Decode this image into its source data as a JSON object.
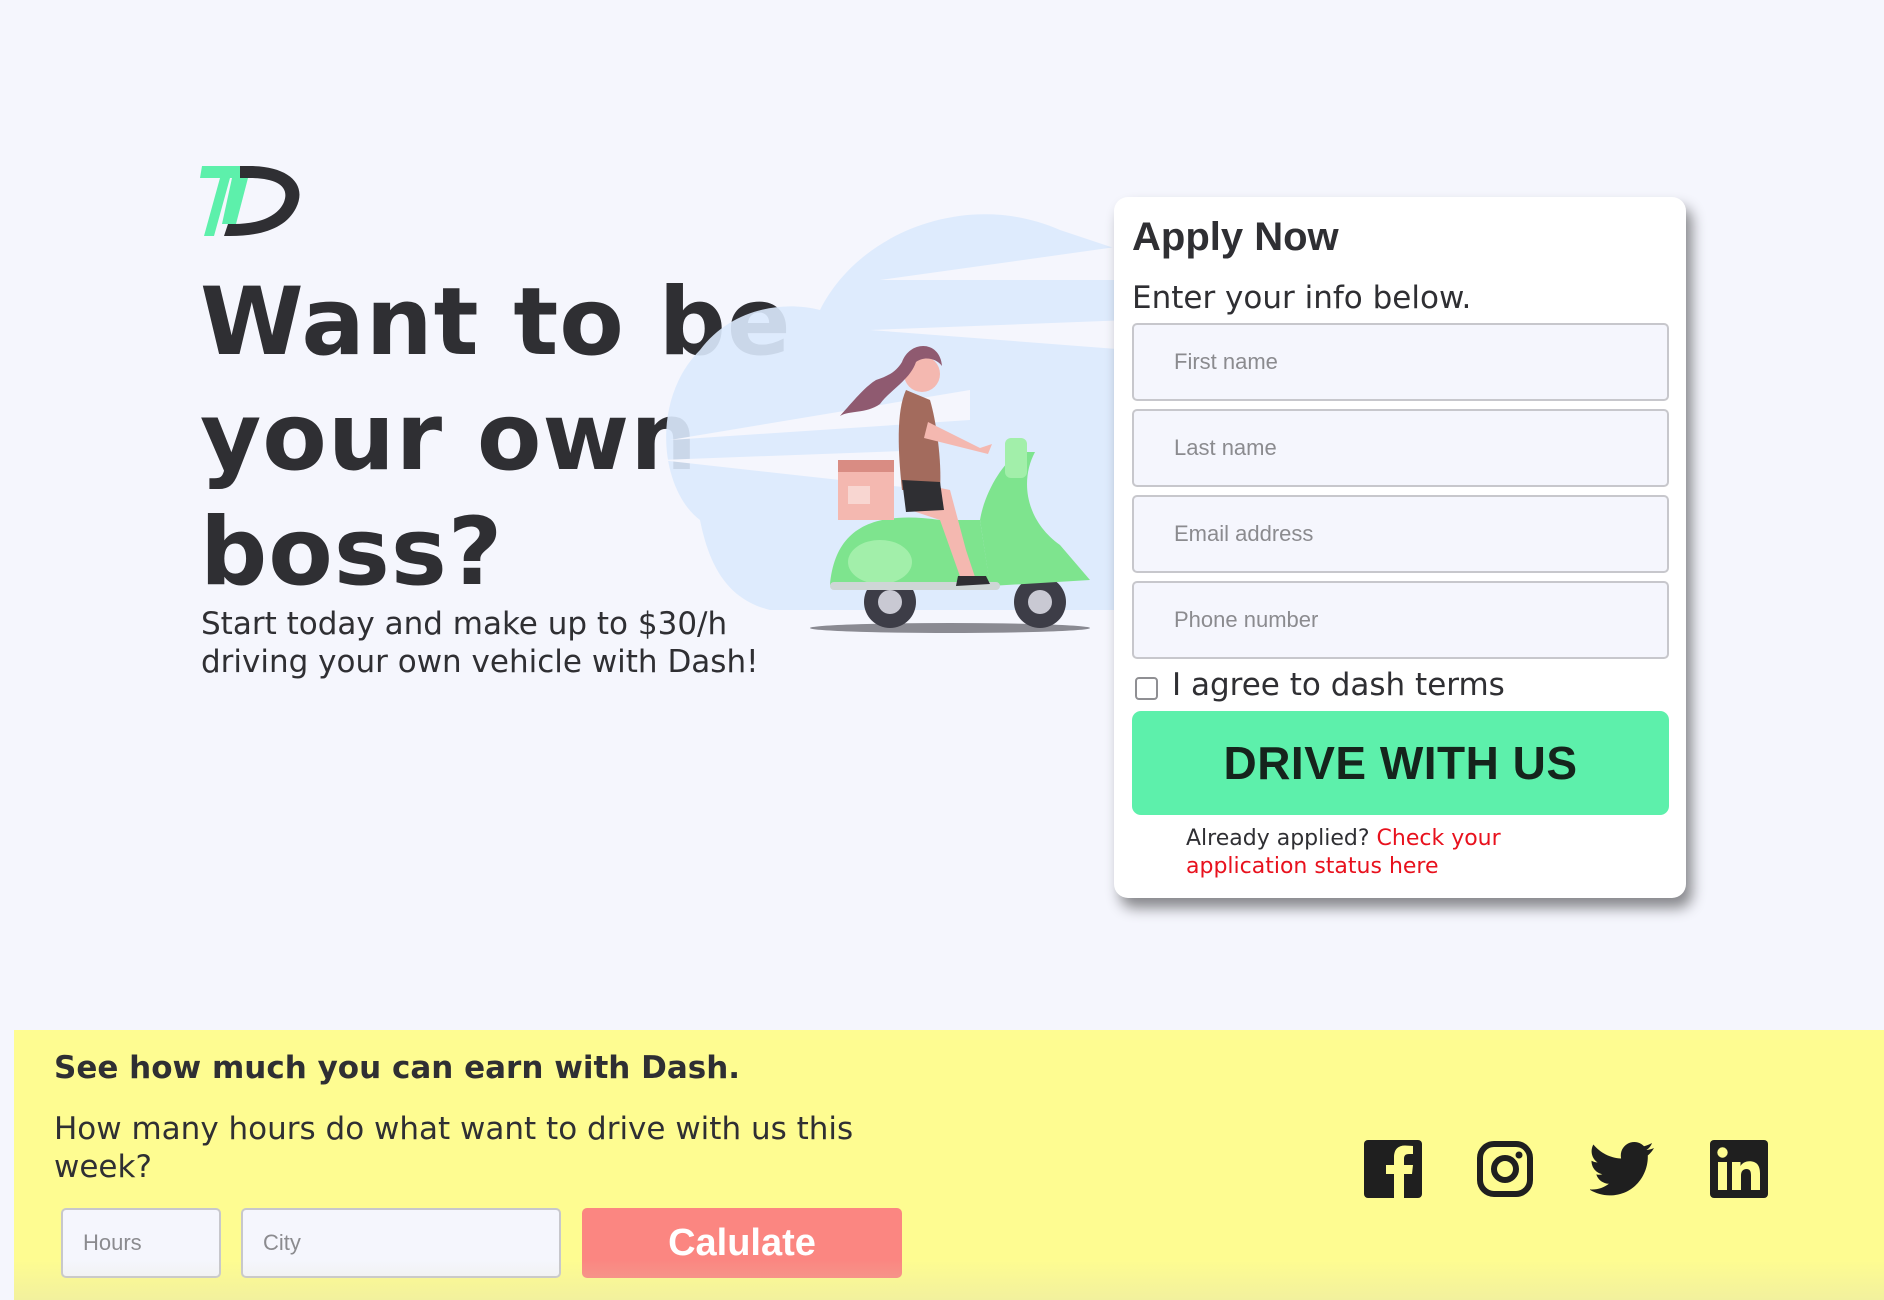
{
  "hero": {
    "logo_icon": "dash-logo-icon",
    "headline": "Want to be your own boss?",
    "subline": "Start today and make up to $30/h driving your own vehicle with Dash!",
    "illustration_icon": "scooter-rider-illustration"
  },
  "apply": {
    "title": "Apply Now",
    "subtitle": "Enter your info below.",
    "first_name_placeholder": "First name",
    "last_name_placeholder": "Last name",
    "email_placeholder": "Email address",
    "phone_placeholder": "Phone number",
    "terms_label": "I agree to dash terms",
    "terms_checked": false,
    "submit_label": "DRIVE WITH US",
    "already_text": "Already applied? ",
    "status_link": "Check your application status here"
  },
  "earn": {
    "title": "See how much you can earn with Dash.",
    "question": "How many hours do what want to drive with us this week?",
    "hours_placeholder": "Hours",
    "city_placeholder": "City",
    "calculate_label": "Calulate"
  },
  "social": [
    "facebook-icon",
    "instagram-icon",
    "twitter-icon",
    "linkedin-icon"
  ],
  "colors": {
    "page_bg": "#f5f6fd",
    "accent_green": "#5df0ab",
    "footer_yellow": "#fefc91",
    "calculate_red": "#fb8681",
    "link_red": "#e8111d",
    "text_dark": "#2f2f33"
  }
}
